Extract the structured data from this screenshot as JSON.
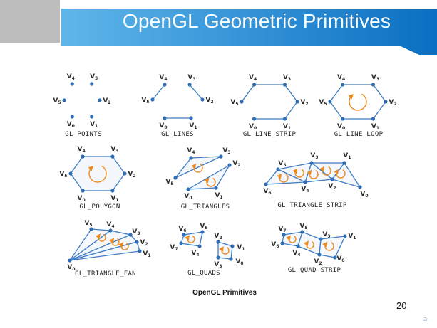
{
  "slide": {
    "title": "OpenGL Geometric Primitives",
    "page_number": "20",
    "corner_mark": "a",
    "figure_caption": "OpenGL Primitives"
  },
  "colors": {
    "banner_light": "#5fb6ea",
    "banner_dark": "#0a6fc2",
    "edge": "#3f7cc4",
    "vertex": "#2f6db5",
    "fill": "#f4f8fd",
    "arrow": "#f08a1c",
    "grey_block": "#bdbdbd"
  },
  "primitives": [
    {
      "id": "points",
      "caption": "GL_POINTS",
      "vertices": [
        "V4",
        "V3",
        "V5",
        "V2",
        "V0",
        "V1"
      ]
    },
    {
      "id": "lines",
      "caption": "GL_LINES",
      "vertices": [
        "V4",
        "V3",
        "V5",
        "V2",
        "V0",
        "V1"
      ]
    },
    {
      "id": "line-strip",
      "caption": "GL_LINE_STRIP",
      "vertices": [
        "V4",
        "V3",
        "V5",
        "V2",
        "V0",
        "V1"
      ]
    },
    {
      "id": "line-loop",
      "caption": "GL_LINE_LOOP",
      "vertices": [
        "V4",
        "V3",
        "V5",
        "V2",
        "V0",
        "V1"
      ]
    },
    {
      "id": "polygon",
      "caption": "GL_POLYGON",
      "vertices": [
        "V4",
        "V3",
        "V5",
        "V2",
        "V0",
        "V1"
      ]
    },
    {
      "id": "triangles",
      "caption": "GL_TRIANGLES",
      "vertices": [
        "V4",
        "V3",
        "V5",
        "V2",
        "V0",
        "V1"
      ]
    },
    {
      "id": "triangle-strip",
      "caption": "GL_TRIANGLE_STRIP",
      "vertices": [
        "V5",
        "V3",
        "V1",
        "V6",
        "V4",
        "V2",
        "V0"
      ]
    },
    {
      "id": "triangle-fan",
      "caption": "GL_TRIANGLE_FAN",
      "vertices": [
        "V5",
        "V4",
        "V3",
        "V2",
        "V1",
        "V0"
      ]
    },
    {
      "id": "quads",
      "caption": "GL_QUADS",
      "vertices": [
        "V6",
        "V5",
        "V7",
        "V4",
        "V2",
        "V1",
        "V3",
        "V0"
      ]
    },
    {
      "id": "quad-strip",
      "caption": "GL_QUAD_STRIP",
      "vertices": [
        "V7",
        "V5",
        "V6",
        "V4",
        "V3",
        "V1",
        "V2",
        "V0"
      ]
    }
  ]
}
